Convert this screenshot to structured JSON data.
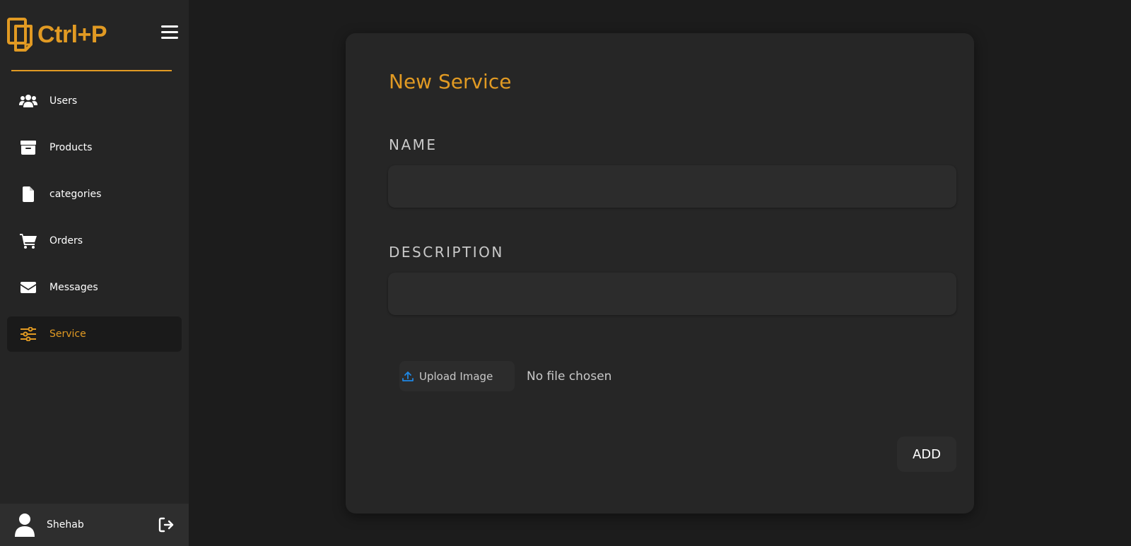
{
  "brand": {
    "name": "Ctrl+P",
    "accent": "#e19a23"
  },
  "sidebar": {
    "items": [
      {
        "label": "Users",
        "icon": "users-icon",
        "active": false
      },
      {
        "label": "Products",
        "icon": "archive-box-icon",
        "active": false
      },
      {
        "label": "categories",
        "icon": "file-icon",
        "active": false
      },
      {
        "label": "Orders",
        "icon": "cart-icon",
        "active": false
      },
      {
        "label": "Messages",
        "icon": "envelope-icon",
        "active": false
      },
      {
        "label": "Service",
        "icon": "sliders-icon",
        "active": true
      }
    ],
    "user": {
      "name": "Shehab"
    }
  },
  "form": {
    "title": "New Service",
    "name_label": "NAME",
    "name_value": "",
    "description_label": "DESCRIPTION",
    "description_value": "",
    "upload_label": "Upload Image",
    "file_status": "No file chosen",
    "submit_label": "ADD"
  }
}
